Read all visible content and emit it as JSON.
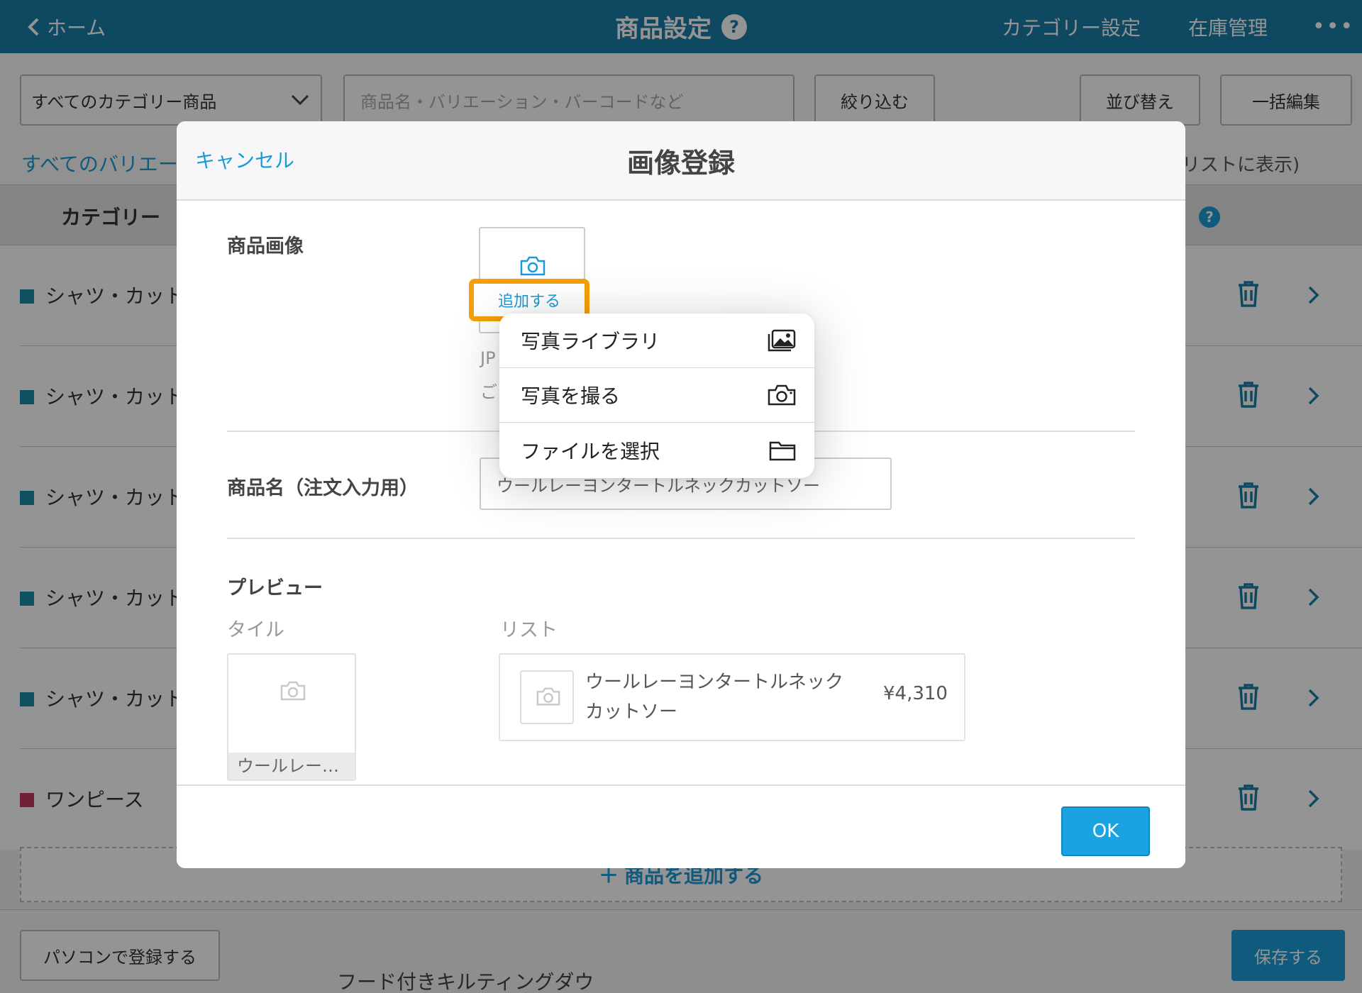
{
  "header": {
    "back_label": "ホーム",
    "title": "商品設定",
    "help_mark": "?",
    "category_settings": "カテゴリー設定",
    "inventory": "在庫管理",
    "more": "•••"
  },
  "filters": {
    "category_select": "すべてのカテゴリー商品",
    "search_placeholder": "商品名・バリエーション・バーコードなど",
    "filter_button": "絞り込む",
    "sort_button": "並び替え",
    "bulk_edit_button": "一括編集",
    "all_variations": "すべてのバリエー",
    "list_display_hint": "・リストに表示)"
  },
  "table": {
    "category_header": "カテゴリー",
    "help_mark": "?",
    "rows": [
      {
        "name": "シャツ・カット",
        "color": "#1a8ba8"
      },
      {
        "name": "シャツ・カット",
        "color": "#1a8ba8"
      },
      {
        "name": "シャツ・カット",
        "color": "#1a8ba8"
      },
      {
        "name": "シャツ・カット",
        "color": "#1a8ba8"
      },
      {
        "name": "シャツ・カット",
        "color": "#1a8ba8"
      },
      {
        "name": "ワンピース",
        "color": "#c0395e"
      }
    ]
  },
  "bottom": {
    "add_product": "商品を追加する",
    "register_on_pc": "パソコンで登録する",
    "save": "保存する",
    "partial_item": "フード付きキルティングダウ"
  },
  "modal": {
    "cancel": "キャンセル",
    "title": "画像登録",
    "product_image_label": "商品画像",
    "add_button": "追加する",
    "hint_fragment_1": "JP",
    "hint_fragment_2": "ご",
    "product_name_label": "商品名（注文入力用）",
    "product_name_value": "ウールレーヨンタートルネックカットソー",
    "preview_label": "プレビュー",
    "tile_label": "タイル",
    "list_label": "リスト",
    "tile_caption": "ウールレー…",
    "list_name": "ウールレーヨンタートルネックカットソー",
    "list_price": "¥4,310",
    "ok": "OK"
  },
  "popover": {
    "items": [
      {
        "label": "写真ライブラリ",
        "icon": "photo-library-icon"
      },
      {
        "label": "写真を撮る",
        "icon": "camera-icon"
      },
      {
        "label": "ファイルを選択",
        "icon": "folder-icon"
      }
    ]
  },
  "colors": {
    "header_blue": "#1a7fa8",
    "accent_blue": "#1a9bd7",
    "highlight_orange": "#f5a00a"
  }
}
